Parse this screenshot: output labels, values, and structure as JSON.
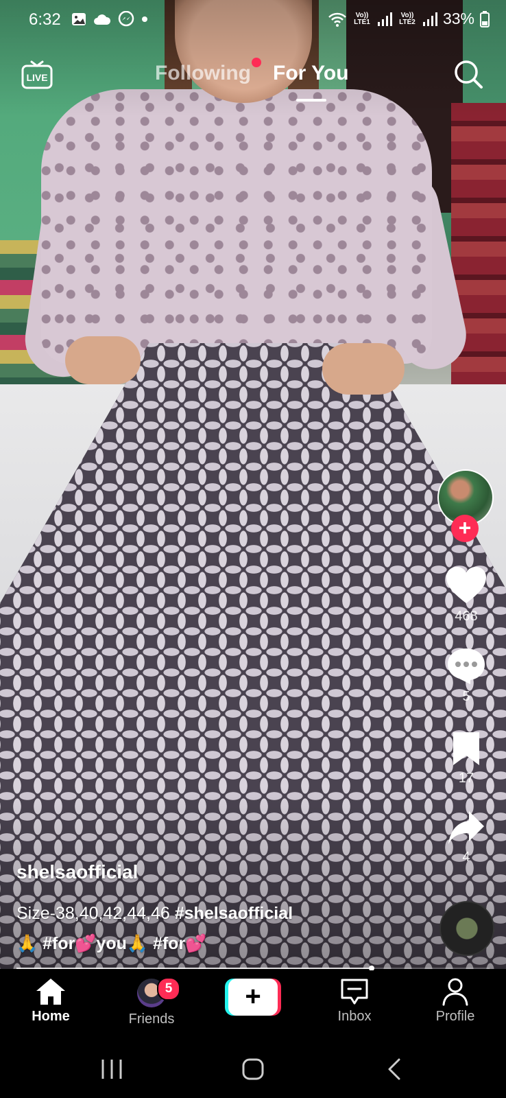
{
  "status_bar": {
    "time": "6:32",
    "network_1": "Vo)) LTE1",
    "network_2": "Vo)) LTE2",
    "battery": "33%"
  },
  "top_nav": {
    "following": "Following",
    "for_you": "For You"
  },
  "actions": {
    "likes": "468",
    "comments": "5",
    "saves": "17",
    "shares": "4"
  },
  "caption": {
    "username": "shelsaofficial",
    "line1_text": "Size-38,40,42,44,46 ",
    "line1_tag": "#shelsaofficial",
    "line2": "🙏 #for💕you🙏 #for💕"
  },
  "video": {
    "progress": 0.75
  },
  "bottom_nav": {
    "home": "Home",
    "friends": "Friends",
    "friends_badge": "5",
    "create": "+",
    "inbox": "Inbox",
    "profile": "Profile"
  },
  "colors": {
    "accent": "#fe2c55",
    "cyan": "#25f4ee"
  }
}
